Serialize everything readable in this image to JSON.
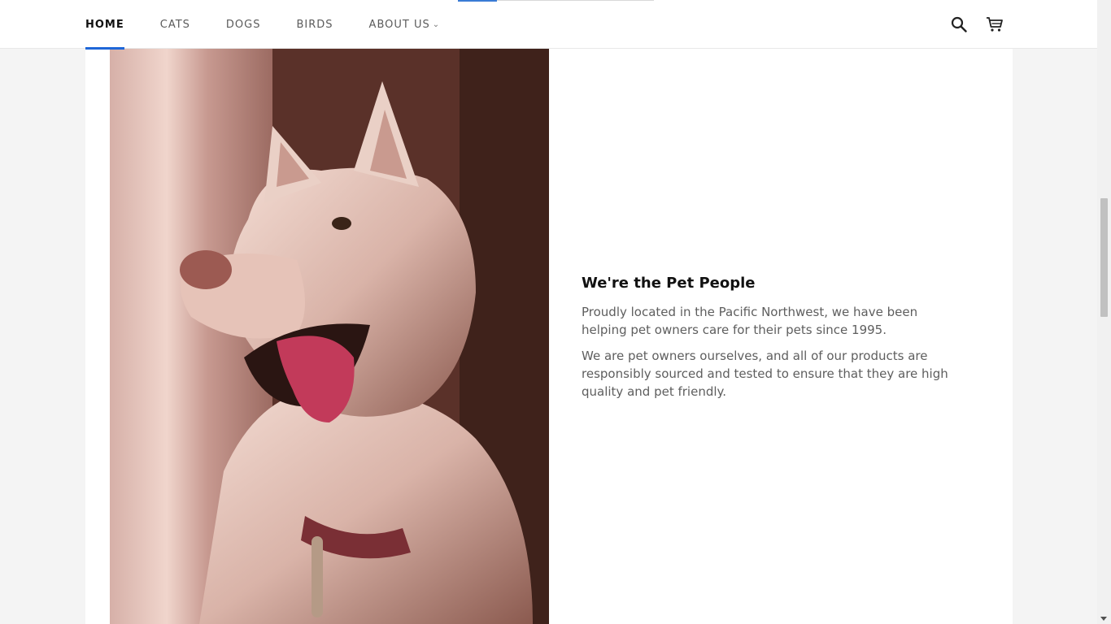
{
  "nav": {
    "items": [
      {
        "label": "HOME",
        "active": true
      },
      {
        "label": "CATS",
        "active": false
      },
      {
        "label": "DOGS",
        "active": false
      },
      {
        "label": "BIRDS",
        "active": false
      },
      {
        "label": "ABOUT US",
        "active": false,
        "dropdown": true
      }
    ],
    "dropdown_glyph": "⌄"
  },
  "header_icons": [
    "search-icon",
    "cart-icon"
  ],
  "feature": {
    "image": "dog-photo",
    "title": "We're the Pet People",
    "paragraphs": [
      "Proudly located in the Pacific Northwest, we have been helping pet owners care for their pets since 1995.",
      "We are pet owners ourselves, and all of our products are responsibly sourced and tested to ensure that they are high quality and pet friendly."
    ]
  },
  "colors": {
    "accent": "#1f67d8",
    "background": "#f4f4f4",
    "panel": "#ffffff",
    "text": "#5e5e5e"
  }
}
